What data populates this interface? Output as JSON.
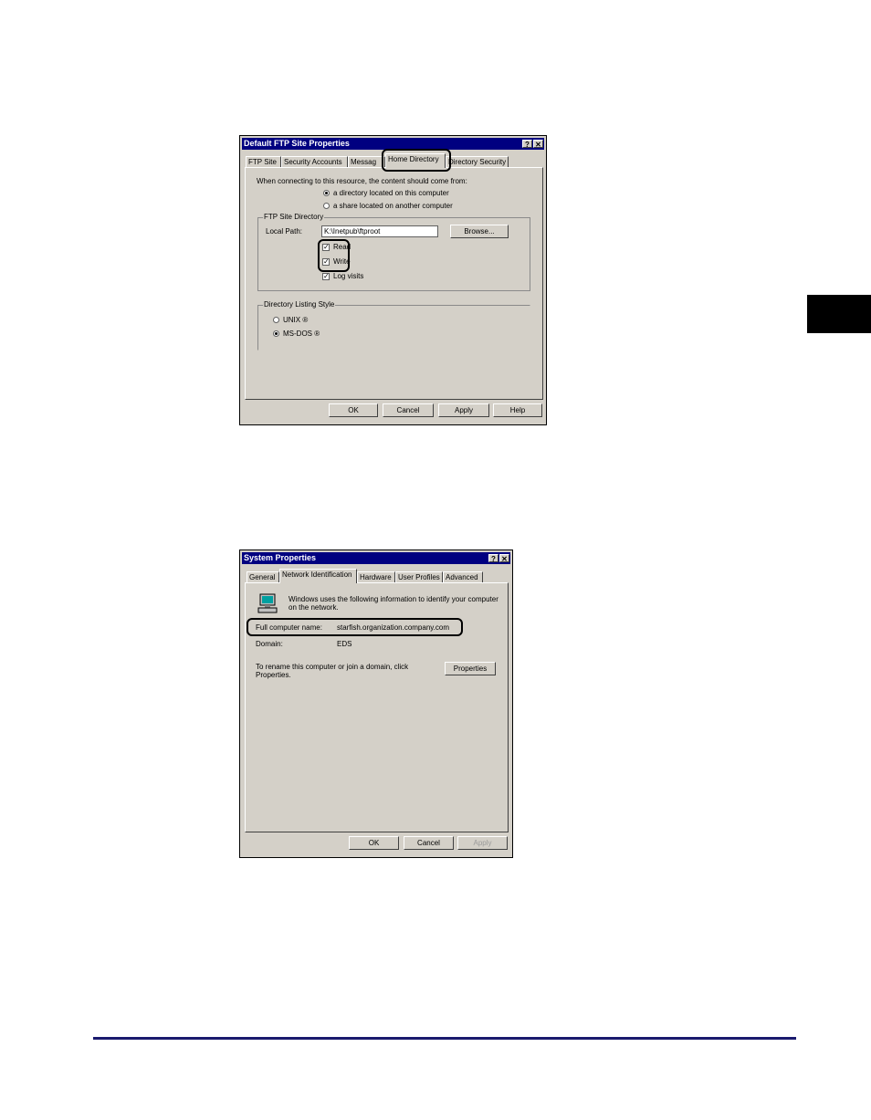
{
  "ftp_dialog": {
    "title": "Default FTP Site Properties",
    "title_help": "?",
    "title_close": "✕",
    "tabs": [
      "FTP Site",
      "Security Accounts",
      "Messages",
      "Home Directory",
      "Directory Security"
    ],
    "tabs_display": [
      "FTP Site",
      "Security Accounts",
      "Messag",
      "Home Directory",
      "Directory Security"
    ],
    "active_tab": "Home Directory",
    "intro": "When connecting to this resource, the content should come from:",
    "radio_local": "a directory located on this computer",
    "radio_share": "a share located on another computer",
    "group_title": "FTP Site Directory",
    "local_path_label": "Local Path:",
    "local_path_value": "K:\\Inetpub\\ftproot",
    "browse_label": "Browse...",
    "read_label": "Read",
    "write_label": "Write",
    "log_label": "Log visits",
    "listing_title": "Directory Listing Style",
    "unix_label": "UNIX ®",
    "msdos_label": "MS-DOS ®",
    "ok": "OK",
    "cancel": "Cancel",
    "apply": "Apply",
    "help": "Help"
  },
  "sys_dialog": {
    "title": "System Properties",
    "title_help": "?",
    "title_close": "✕",
    "tabs": [
      "General",
      "Network Identification",
      "Hardware",
      "User Profiles",
      "Advanced"
    ],
    "active_tab": "Network Identification",
    "info_line1": "Windows uses the following information to identify your computer",
    "info_line2": "on the network.",
    "full_name_label": "Full computer name:",
    "full_name_value": "starfish.organization.company.com",
    "domain_label": "Domain:",
    "domain_value": "EDS",
    "rename_line1": "To rename this computer or join a domain, click",
    "rename_line2": "Properties.",
    "properties_label": "Properties",
    "ok": "OK",
    "cancel": "Cancel",
    "apply": "Apply"
  }
}
